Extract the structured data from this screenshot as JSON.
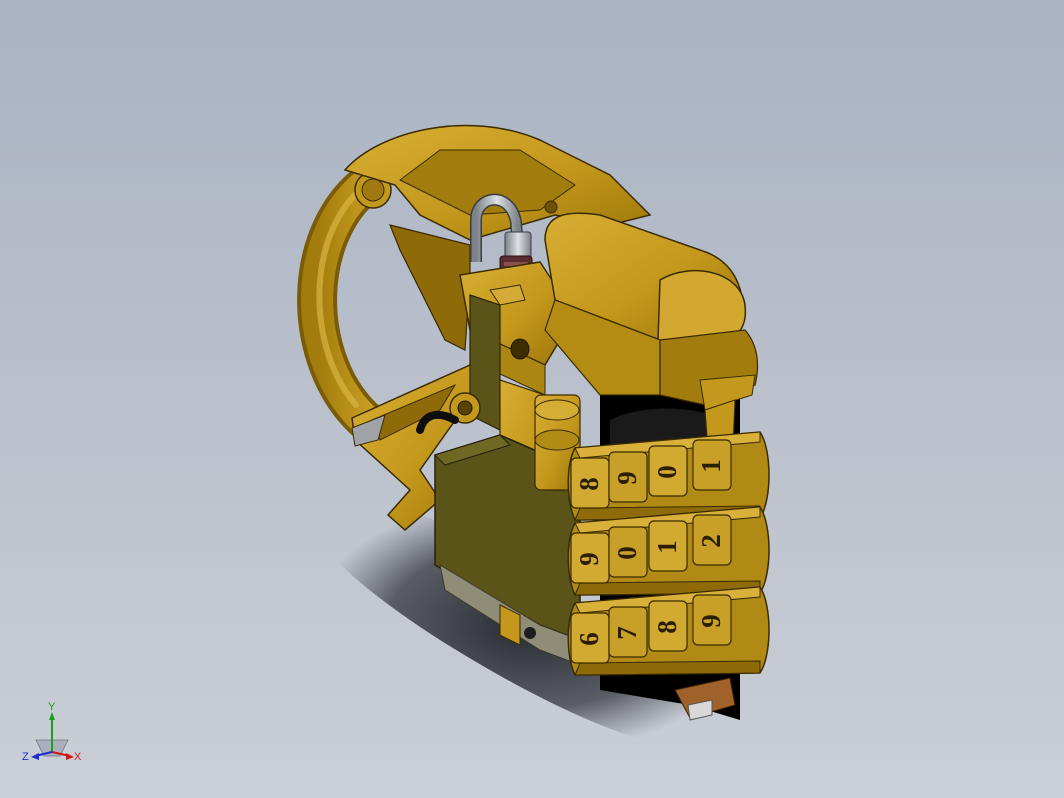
{
  "triad": {
    "y_label": "Y",
    "x_label": "X",
    "z_label": "Z",
    "y_color": "#1aa01a",
    "x_color": "#d01818",
    "z_color": "#1a2ed0"
  },
  "lock": {
    "body_color": "#c4981c",
    "shadow_color": "#7a5c06",
    "dark_cavity_color": "#000000",
    "olive_panel_color": "#5a5418",
    "wheels": [
      {
        "digits": [
          "8",
          "9",
          "0",
          "1"
        ]
      },
      {
        "digits": [
          "9",
          "0",
          "1",
          "2"
        ]
      },
      {
        "digits": [
          "6",
          "7",
          "8",
          "9"
        ]
      }
    ]
  }
}
